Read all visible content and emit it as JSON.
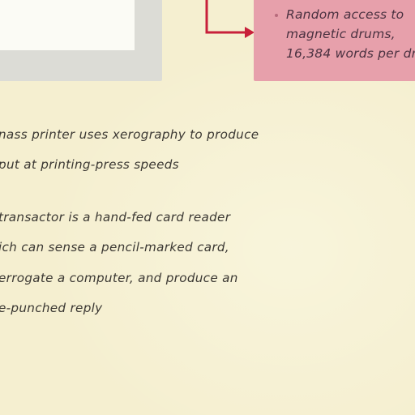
{
  "callout": {
    "lines": [
      "Random access to",
      "magnetic drums,",
      "16,384 words per dr"
    ]
  },
  "paragraphs": [
    {
      "lines": [
        "nass printer uses xerography to produce",
        "put at printing-press speeds"
      ]
    },
    {
      "lines": [
        "transactor is a hand-fed card reader",
        "ich can sense a pencil-marked card,",
        "errogate a computer, and produce an",
        "e-punched reply"
      ]
    }
  ],
  "colors": {
    "paper": "#f5efd0",
    "callout_fill": "#e7a0ab",
    "arrow": "#c8203a",
    "text": "#3b3833"
  }
}
